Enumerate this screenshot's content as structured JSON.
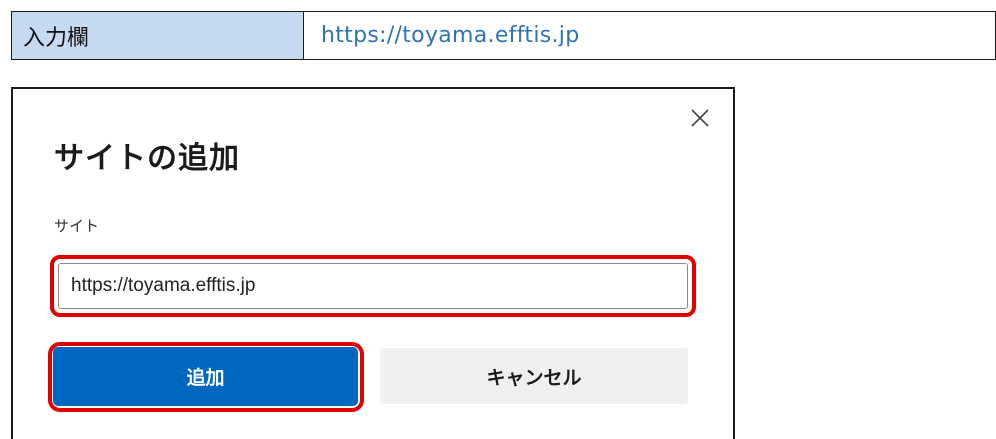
{
  "info_table": {
    "label": "入力欄",
    "value": "https://toyama.efftis.jp"
  },
  "dialog": {
    "title": "サイトの追加",
    "close_icon": "close-icon",
    "field_label": "サイト",
    "site_input_value": "https://toyama.efftis.jp",
    "add_label": "追加",
    "cancel_label": "キャンセル"
  },
  "colors": {
    "label_cell_bg": "#c5d9f1",
    "link_text": "#2e74b5",
    "primary_button": "#0067c0",
    "highlight_border": "#e00000",
    "secondary_button": "#efefef"
  }
}
